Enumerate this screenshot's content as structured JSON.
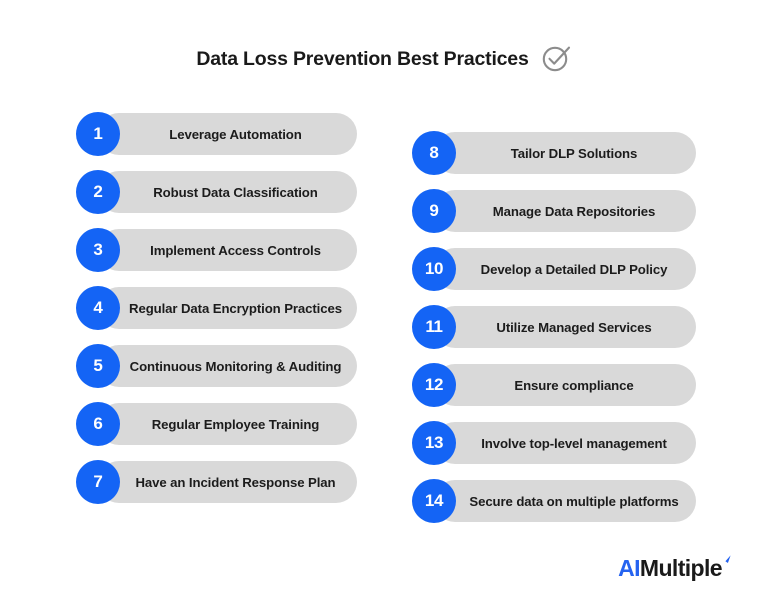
{
  "header": {
    "title": "Data Loss Prevention Best Practices",
    "icon": "check-circle-icon"
  },
  "colors": {
    "badge_blue": "#1464F5",
    "pill_gray": "#D9D9D9",
    "text_dark": "#1C1C1C",
    "background": "#FFFFFF",
    "logo_blue": "#2563F0",
    "icon_gray": "#8C8C8C"
  },
  "columns": {
    "left": [
      {
        "number": "1",
        "label": "Leverage Automation"
      },
      {
        "number": "2",
        "label": "Robust Data Classification"
      },
      {
        "number": "3",
        "label": "Implement Access Controls"
      },
      {
        "number": "4",
        "label": "Regular Data Encryption Practices"
      },
      {
        "number": "5",
        "label": "Continuous Monitoring & Auditing"
      },
      {
        "number": "6",
        "label": "Regular Employee Training"
      },
      {
        "number": "7",
        "label": "Have an Incident Response Plan"
      }
    ],
    "right": [
      {
        "number": "8",
        "label": "Tailor DLP Solutions"
      },
      {
        "number": "9",
        "label": "Manage Data Repositories"
      },
      {
        "number": "10",
        "label": "Develop a Detailed DLP Policy"
      },
      {
        "number": "11",
        "label": "Utilize Managed Services"
      },
      {
        "number": "12",
        "label": "Ensure compliance"
      },
      {
        "number": "13",
        "label": "Involve top-level management"
      },
      {
        "number": "14",
        "label": "Secure data on multiple platforms"
      }
    ]
  },
  "logo": {
    "prefix": "AI",
    "suffix": "Multiple",
    "tick_icon": "tick-mark-icon"
  }
}
